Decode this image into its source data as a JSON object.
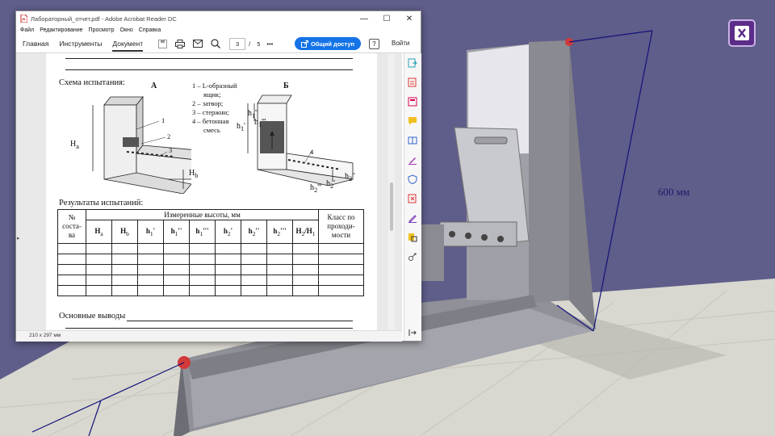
{
  "scene": {
    "dimension_label": "600 мм"
  },
  "window": {
    "title": "Лабораторный_отчет.pdf - Adobe Acrobat Reader DC",
    "controls": {
      "minimize": "—",
      "maximize": "☐",
      "close": "✕"
    },
    "menu": [
      "Файл",
      "Редактирование",
      "Просмотр",
      "Окно",
      "Справка"
    ],
    "tabs": [
      "Главная",
      "Инструменты",
      "Документ"
    ],
    "active_tab": "Документ",
    "page_current": "3",
    "page_sep": "/",
    "page_total": "5",
    "more": "•••",
    "share_label": "Общий доступ",
    "help": "?",
    "login_label": "Войти",
    "page_size": "210 x 297 мм"
  },
  "document": {
    "scheme_title": "Схема испытания:",
    "fig_a": "А",
    "fig_b": "Б",
    "legend": [
      "1 – L-образный",
      "ящик;",
      "2 – затвор;",
      "3 – стержни;",
      "4 – бетонная",
      "смесь"
    ],
    "fig_a_labels": {
      "n1": "1",
      "n2": "2",
      "n3": "3",
      "ha": "H",
      "ha_sub": "a",
      "hb": "H",
      "hb_sub": "b"
    },
    "fig_b_labels": {
      "n4": "4",
      "h1a": "h",
      "h1b": "h",
      "h1c": "h",
      "h2a": "h",
      "h2b": "h",
      "h2c": "h"
    },
    "results_title": "Результаты испытаний:",
    "table": {
      "col_no": [
        "№",
        "соста-",
        "ва"
      ],
      "group_header": "Измеренные высоты, мм",
      "class_header": [
        "Класс по",
        "проходи-",
        "мости"
      ],
      "subheaders": [
        {
          "m": "H",
          "s": "a",
          "p": ""
        },
        {
          "m": "H",
          "s": "b",
          "p": ""
        },
        {
          "m": "h",
          "s": "1",
          "p": "'"
        },
        {
          "m": "h",
          "s": "1",
          "p": "''"
        },
        {
          "m": "h",
          "s": "1",
          "p": "'''"
        },
        {
          "m": "h",
          "s": "2",
          "p": "'"
        },
        {
          "m": "h",
          "s": "2",
          "p": "''"
        },
        {
          "m": "h",
          "s": "2",
          "p": "'''"
        },
        {
          "m": "H",
          "s": "2",
          "p": "/H",
          "s2": "1"
        }
      ],
      "empty_rows": 5
    },
    "conclusions": "Основные выводы"
  }
}
